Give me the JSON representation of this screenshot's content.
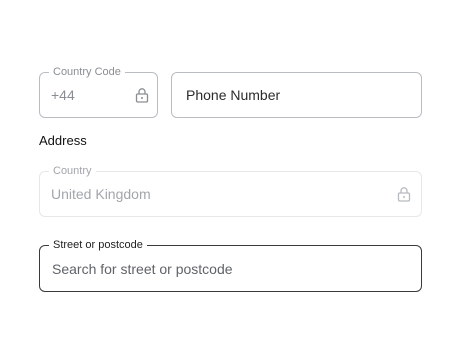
{
  "phone": {
    "country_code": {
      "label": "Country Code",
      "value": "+44",
      "icon": "lock-icon",
      "locked": true
    },
    "number": {
      "placeholder": "Phone Number"
    }
  },
  "address": {
    "heading": "Address",
    "country": {
      "label": "Country",
      "value": "United Kingdom",
      "icon": "lock-icon",
      "disabled": true
    },
    "street": {
      "label": "Street or postcode",
      "placeholder": "Search for street or postcode",
      "value": "",
      "focused": true
    }
  },
  "colors": {
    "border_default": "#b9bdc2",
    "border_disabled": "#e6e7e9",
    "border_focused": "#3a3a3a",
    "text_muted": "#8a8e93"
  }
}
